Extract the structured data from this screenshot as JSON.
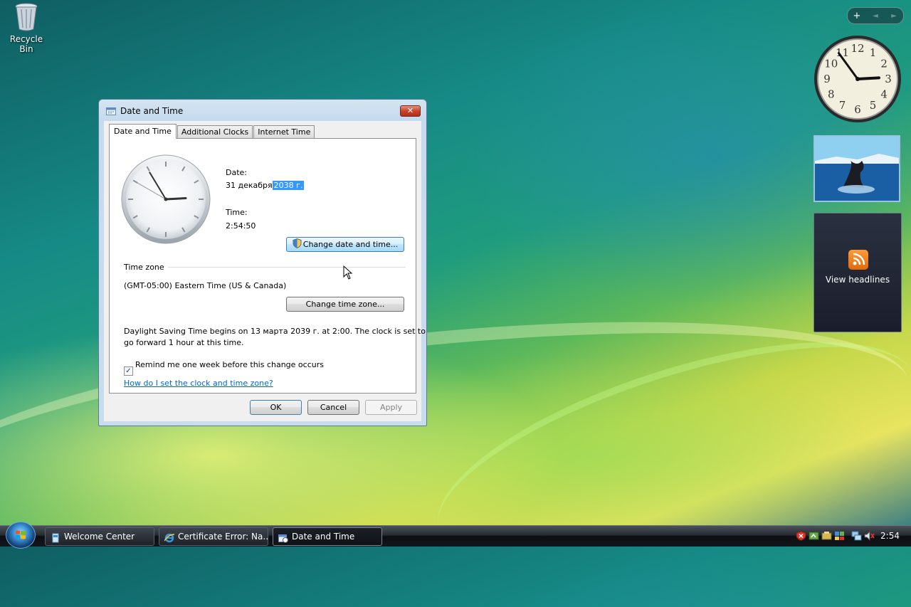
{
  "desktop": {
    "icons": [
      {
        "label": "Recycle Bin",
        "icon": "recycle-bin-icon"
      }
    ]
  },
  "sidebar": {
    "toolbar": {
      "add": "+",
      "prev": "◄",
      "next": "►"
    },
    "clock_gadget": {
      "numbers": [
        "12",
        "1",
        "2",
        "3",
        "4",
        "5",
        "6",
        "7",
        "8",
        "9",
        "10",
        "11"
      ],
      "hour": 2,
      "minute": 54
    },
    "slideshow": {
      "icon": "whale-tail-photo"
    },
    "feed": {
      "label": "View headlines",
      "icon": "rss-icon"
    }
  },
  "dialog": {
    "title": "Date and Time",
    "close_glyph": "✕",
    "tabs": [
      {
        "label": "Date and Time",
        "active": true
      },
      {
        "label": "Additional Clocks",
        "active": false
      },
      {
        "label": "Internet Time",
        "active": false
      }
    ],
    "date_label": "Date:",
    "date_value_part1": "31 декабря",
    "date_value_selected": "2038 г.",
    "time_label": "Time:",
    "time_value": "2:54:50",
    "change_date_button": "Change date and time...",
    "timezone_group": "Time zone",
    "timezone_value": "(GMT-05:00) Eastern Time (US & Canada)",
    "change_timezone_button": "Change time zone...",
    "dst_line1": "Daylight Saving Time begins on 13 марта 2039 г. at 2:00. The clock is set to",
    "dst_line2": "go forward 1 hour at this time.",
    "remind_checkbox": {
      "label": "Remind me one week before this change occurs",
      "checked": true,
      "glyph": "✓"
    },
    "help_link": "How do I set the clock and time zone?",
    "ok_button": "OK",
    "cancel_button": "Cancel",
    "apply_button": "Apply"
  },
  "taskbar": {
    "tasks": [
      {
        "label": "Welcome Center",
        "active": false,
        "icon": "welcome-center-icon"
      },
      {
        "label": "Certificate Error: Na...",
        "active": false,
        "icon": "internet-explorer-icon"
      },
      {
        "label": "Date and Time",
        "active": true,
        "icon": "date-time-icon"
      }
    ],
    "clock": "2:54"
  }
}
